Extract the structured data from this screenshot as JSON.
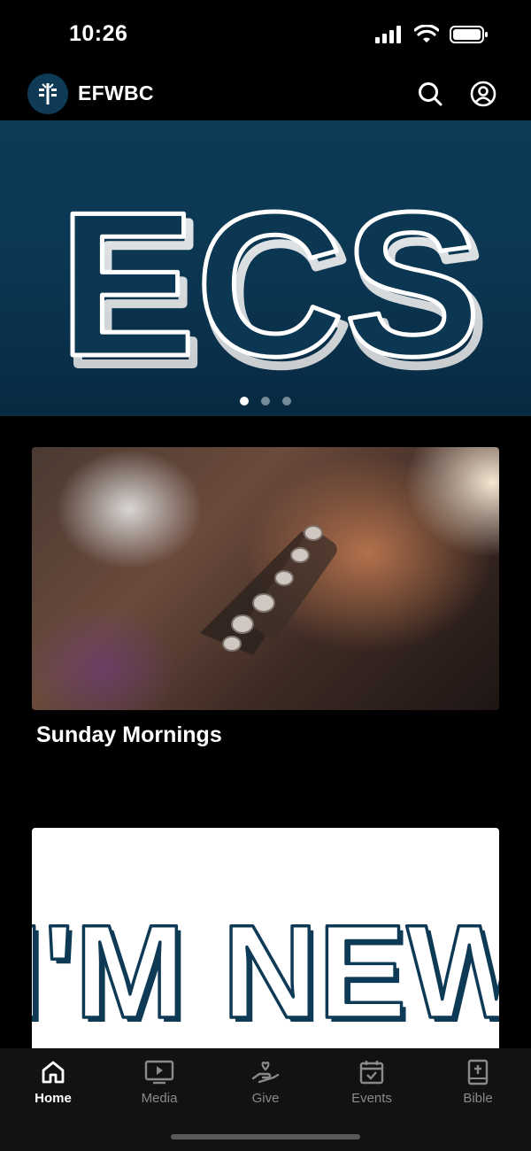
{
  "status_bar": {
    "time": "10:26",
    "icons": [
      "signal-icon",
      "wifi-icon",
      "battery-icon"
    ]
  },
  "header": {
    "title": "EFWBC",
    "logo_icon": "church-logo-icon",
    "search_icon": "search-icon",
    "profile_icon": "profile-icon"
  },
  "carousel": {
    "slide_text": "ECS",
    "slide_count": 3,
    "active_index": 0
  },
  "cards": [
    {
      "title": "Sunday Mornings",
      "image": "guitar-photo"
    },
    {
      "title": "",
      "image_text": "I'M NEW"
    }
  ],
  "tabs": [
    {
      "label": "Home",
      "icon": "home-icon",
      "active": true
    },
    {
      "label": "Media",
      "icon": "media-icon",
      "active": false
    },
    {
      "label": "Give",
      "icon": "give-icon",
      "active": false
    },
    {
      "label": "Events",
      "icon": "events-icon",
      "active": false
    },
    {
      "label": "Bible",
      "icon": "bible-icon",
      "active": false
    }
  ],
  "colors": {
    "brand": "#0c3b57",
    "background": "#000000",
    "tab_bar": "#121212",
    "tab_inactive": "#8a8a8a",
    "tab_active": "#ffffff"
  }
}
